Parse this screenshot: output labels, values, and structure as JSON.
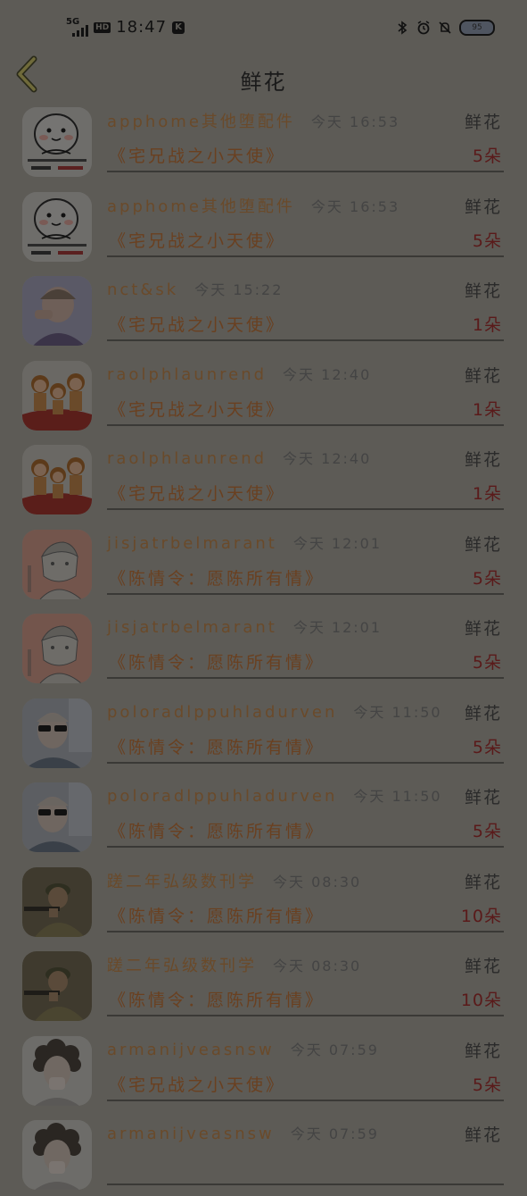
{
  "status_bar": {
    "network": "5G",
    "hd": "HD",
    "time": "18:47",
    "k_badge": "K",
    "battery": "95"
  },
  "header": {
    "title": "鲜花"
  },
  "records": [
    {
      "name": "apphome其他堕配件",
      "time": "今天 16:53",
      "gift_type": "鲜花",
      "title": "《宅兄战之小天使》",
      "count": "5朵",
      "avatar": "meme-face"
    },
    {
      "name": "apphome其他堕配件",
      "time": "今天 16:53",
      "gift_type": "鲜花",
      "title": "《宅兄战之小天使》",
      "count": "5朵",
      "avatar": "meme-face"
    },
    {
      "name": "nct&sk",
      "time": "今天 15:22",
      "gift_type": "鲜花",
      "title": "《宅兄战之小天使》",
      "count": "1朵",
      "avatar": "photo-person"
    },
    {
      "name": "raolphlaunrend",
      "time": "今天 12:40",
      "gift_type": "鲜花",
      "title": "《宅兄战之小天使》",
      "count": "1朵",
      "avatar": "cartoon-group"
    },
    {
      "name": "raolphlaunrend",
      "time": "今天 12:40",
      "gift_type": "鲜花",
      "title": "《宅兄战之小天使》",
      "count": "1朵",
      "avatar": "cartoon-group"
    },
    {
      "name": "jisjatrbelmarant",
      "time": "今天 12:01",
      "gift_type": "鲜花",
      "title": "《陈情令：愿陈所有情》",
      "count": "5朵",
      "avatar": "anime-sketch"
    },
    {
      "name": "jisjatrbelmarant",
      "time": "今天 12:01",
      "gift_type": "鲜花",
      "title": "《陈情令：愿陈所有情》",
      "count": "5朵",
      "avatar": "anime-sketch"
    },
    {
      "name": "poloradlppuhladurven",
      "time": "今天 11:50",
      "gift_type": "鲜花",
      "title": "《陈情令：愿陈所有情》",
      "count": "5朵",
      "avatar": "sunglasses-man"
    },
    {
      "name": "poloradlppuhladurven",
      "time": "今天 11:50",
      "gift_type": "鲜花",
      "title": "《陈情令：愿陈所有情》",
      "count": "5朵",
      "avatar": "sunglasses-man"
    },
    {
      "name": "蹉二年弘级数刊学",
      "time": "今天 08:30",
      "gift_type": "鲜花",
      "title": "《陈情令：愿陈所有情》",
      "count": "10朵",
      "avatar": "soldier"
    },
    {
      "name": "蹉二年弘级数刊学",
      "time": "今天 08:30",
      "gift_type": "鲜花",
      "title": "《陈情令：愿陈所有情》",
      "count": "10朵",
      "avatar": "soldier"
    },
    {
      "name": "armanijveasnsw",
      "time": "今天 07:59",
      "gift_type": "鲜花",
      "title": "《宅兄战之小天使》",
      "count": "5朵",
      "avatar": "curly-hair"
    },
    {
      "name": "armanijveasnsw",
      "time": "今天 07:59",
      "gift_type": "鲜花",
      "title": "",
      "count": "",
      "avatar": "curly-hair"
    }
  ]
}
